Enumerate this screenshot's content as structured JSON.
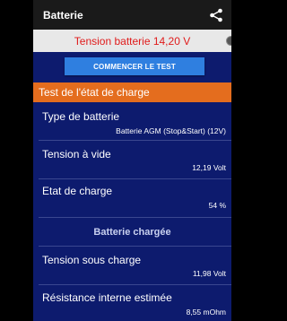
{
  "app": {
    "title": "Batterie",
    "share_icon": "share-icon"
  },
  "banner": {
    "voltage": "Tension batterie 14,20 V"
  },
  "actions": {
    "start_test": "COMMENCER LE TEST"
  },
  "section": {
    "title": "Test de l'état de charge"
  },
  "rows": [
    {
      "label": "Type de batterie",
      "value": "Batterie AGM (Stop&Start) (12V)"
    },
    {
      "label": "Tension à vide",
      "value": "12,19 Volt"
    },
    {
      "label": "Etat de charge",
      "value": "54 %"
    }
  ],
  "status": {
    "text": "Batterie chargée"
  },
  "rows2": [
    {
      "label": "Tension sous charge",
      "value": "11,98 Volt"
    },
    {
      "label": "Résistance interne estimée",
      "value": "8,55 mOhm"
    }
  ],
  "colors": {
    "appbar": "#1a1a1a",
    "background": "#0d1b6e",
    "banner": "#e8e8e8",
    "voltage_text": "#e01b1b",
    "button": "#2f7fe0",
    "section_header": "#e46d1e"
  }
}
